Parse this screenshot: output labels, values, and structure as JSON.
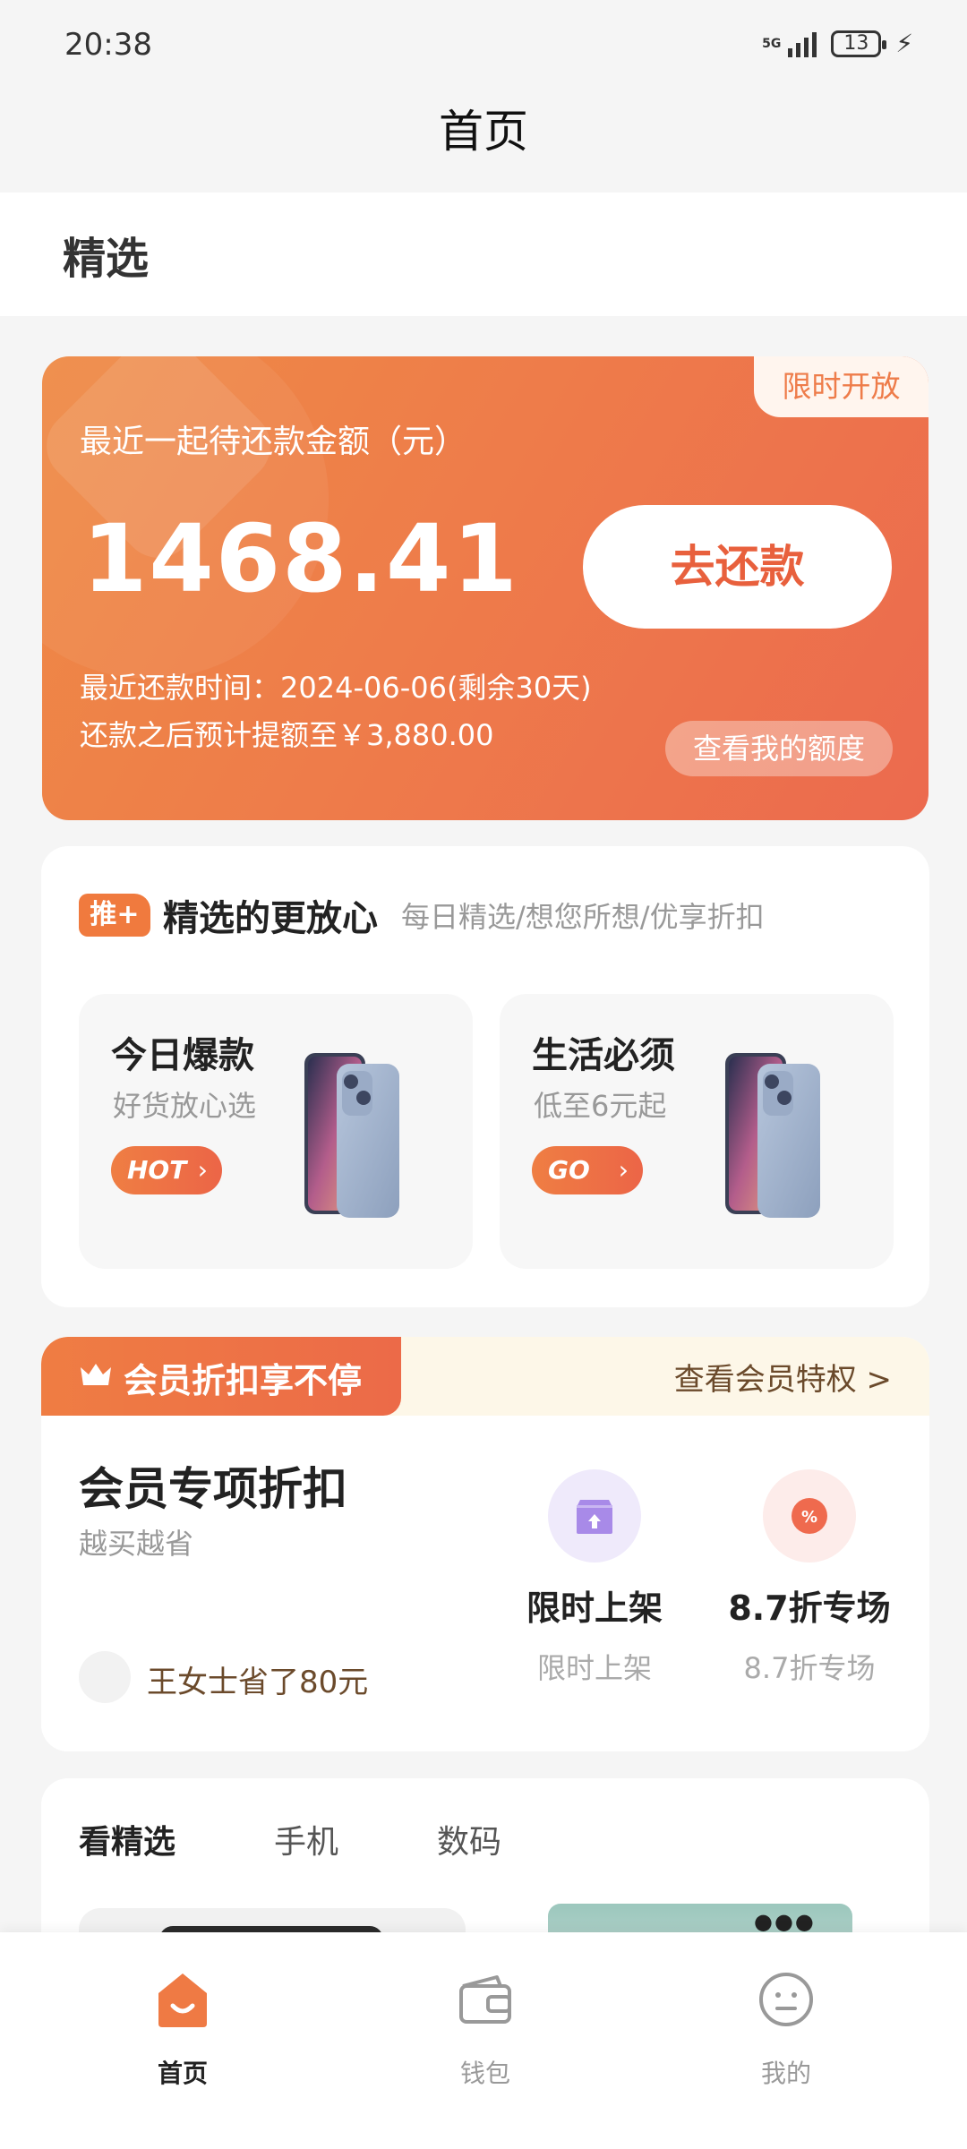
{
  "status_bar": {
    "time": "20:38",
    "network": "5G",
    "battery": "13"
  },
  "header": {
    "title": "首页"
  },
  "section": {
    "title": "精选"
  },
  "repay_card": {
    "tag": "限时开放",
    "label": "最近一起待还款金额（元）",
    "amount": "1468.41",
    "button_label": "去还款",
    "due_line": "最近还款时间：2024-06-06(剩余30天)",
    "quota_line": "还款之后预计提额至￥3,880.00",
    "quota_button": "查看我的额度"
  },
  "picks": {
    "badge": "推+",
    "title": "精选的更放心",
    "subtitle": "每日精选/想您所想/优享折扣",
    "items": [
      {
        "title": "今日爆款",
        "subtitle": "好货放心选",
        "pill": "HOT"
      },
      {
        "title": "生活必须",
        "subtitle": "低至6元起",
        "pill": "GO"
      }
    ]
  },
  "member": {
    "tag": "会员折扣享不停",
    "link": "查看会员特权 >",
    "title": "会员专项折扣",
    "subtitle": "越买越省",
    "saved": "王女士省了80元",
    "features": [
      {
        "title": "限时上架",
        "subtitle": "限时上架",
        "icon": "upload-icon"
      },
      {
        "title": "8.7折专场",
        "subtitle": "8.7折专场",
        "icon": "discount-icon"
      }
    ]
  },
  "browse": {
    "tabs": [
      "看精选",
      "手机",
      "数码"
    ],
    "active_tab": 0
  },
  "bottom_nav": {
    "items": [
      {
        "label": "首页",
        "icon": "home-icon",
        "active": true
      },
      {
        "label": "钱包",
        "icon": "wallet-icon",
        "active": false
      },
      {
        "label": "我的",
        "icon": "profile-icon",
        "active": false
      }
    ]
  },
  "colors": {
    "accent": "#ee7c4a",
    "accent_dark": "#e8603d",
    "background": "#f5f5f5",
    "member_bg": "#fdf7e8",
    "member_text": "#6b4a2b"
  }
}
